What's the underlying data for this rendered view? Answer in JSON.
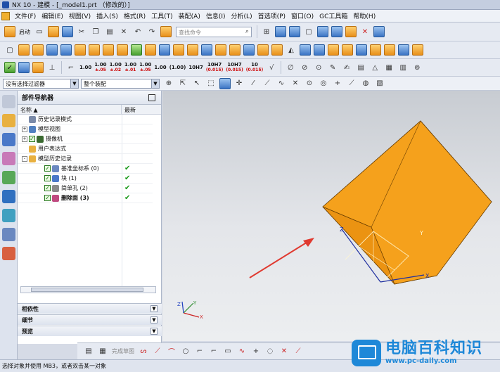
{
  "window": {
    "title": "NX 10 - 建模 - [_model1.prt （修改的）]"
  },
  "menu": [
    "文件(F)",
    "编辑(E)",
    "视图(V)",
    "插入(S)",
    "格式(R)",
    "工具(T)",
    "装配(A)",
    "信息(I)",
    "分析(L)",
    "首选项(P)",
    "窗口(O)",
    "GC工具箱",
    "帮助(H)"
  ],
  "toolbar": {
    "start_label": "启动",
    "search_placeholder": "查找命令",
    "numbers": [
      {
        "top": "1.00",
        "sub": ""
      },
      {
        "top": "1.00",
        "sub": "±.05"
      },
      {
        "top": "1.00",
        "sub": "±.02"
      },
      {
        "top": "1.00",
        "sub": "±.01"
      },
      {
        "top": "1.00",
        "sub": "±.05"
      },
      {
        "top": "1.00",
        "sub": ""
      },
      {
        "top": "(1.00)",
        "sub": ""
      },
      {
        "top": "10H7",
        "sub": ""
      },
      {
        "top": "10H7",
        "sub": "(0.015)"
      },
      {
        "top": "10H7",
        "sub": "(0.015)"
      },
      {
        "top": "10",
        "sub": "(0.015)"
      }
    ]
  },
  "selection": {
    "filter": "没有选择过滤器",
    "scope": "整个装配"
  },
  "navigator": {
    "title": "部件导航器",
    "col_name": "名称",
    "col_latest": "最新",
    "rows": [
      {
        "label": "历史记录模式",
        "indent": 0,
        "expand": "",
        "check": false,
        "latest": false,
        "bold": false
      },
      {
        "label": "模型视图",
        "indent": 0,
        "expand": "+",
        "check": false,
        "latest": false,
        "bold": false
      },
      {
        "label": "摄像机",
        "indent": 0,
        "expand": "+",
        "check": true,
        "latest": false,
        "bold": false
      },
      {
        "label": "用户表达式",
        "indent": 0,
        "expand": "",
        "check": false,
        "latest": false,
        "bold": false
      },
      {
        "label": "模型历史记录",
        "indent": 0,
        "expand": "-",
        "check": false,
        "latest": false,
        "bold": false
      },
      {
        "label": "基准坐标系 (0)",
        "indent": 1,
        "expand": "",
        "check": true,
        "latest": true,
        "bold": false
      },
      {
        "label": "块 (1)",
        "indent": 1,
        "expand": "",
        "check": true,
        "latest": true,
        "bold": false
      },
      {
        "label": "简单孔 (2)",
        "indent": 1,
        "expand": "",
        "check": true,
        "latest": true,
        "bold": false
      },
      {
        "label": "删除面 (3)",
        "indent": 1,
        "expand": "",
        "check": true,
        "latest": true,
        "bold": true
      }
    ],
    "sections": [
      "相依性",
      "细节",
      "预览"
    ]
  },
  "bottom_toolbar": {
    "finish_sketch": "完成草图"
  },
  "status": {
    "text": "选择对象并使用 MB3，或者双击某一对象"
  },
  "watermark": {
    "title": "电脑百科知识",
    "url": "www.pc-daily.com"
  },
  "colors": {
    "block": "#f5a11c",
    "block_dark": "#c87a0c",
    "arrow": "#e03a30"
  }
}
